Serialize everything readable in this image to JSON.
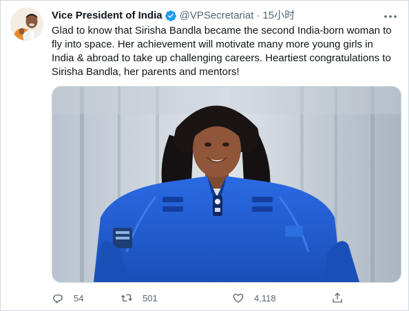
{
  "tweet": {
    "author_name": "Vice President of India",
    "author_handle": "@VPSecretariat",
    "separator": "·",
    "time_ago": "15小时",
    "verified": true,
    "text": "Glad to know that Sirisha Bandla became the second India-born woman to fly into space. Her achievement will motivate many more young girls in India & abroad to take up challenging careers. Heartiest congratulations to Sirisha Bandla, her parents and mentors!"
  },
  "actions": {
    "reply_count": "54",
    "retweet_count": "501",
    "like_count": "4,118"
  },
  "icons": {
    "avatar": "profile-avatar",
    "verified": "verified-badge-icon",
    "more": "more-options-icon",
    "reply": "reply-icon",
    "retweet": "retweet-icon",
    "like": "heart-icon",
    "share": "share-icon"
  },
  "colors": {
    "verified_blue": "#1d9bf0",
    "text_primary": "#0f1419",
    "text_secondary": "#536471",
    "suit_blue": "#1f5fd6"
  }
}
